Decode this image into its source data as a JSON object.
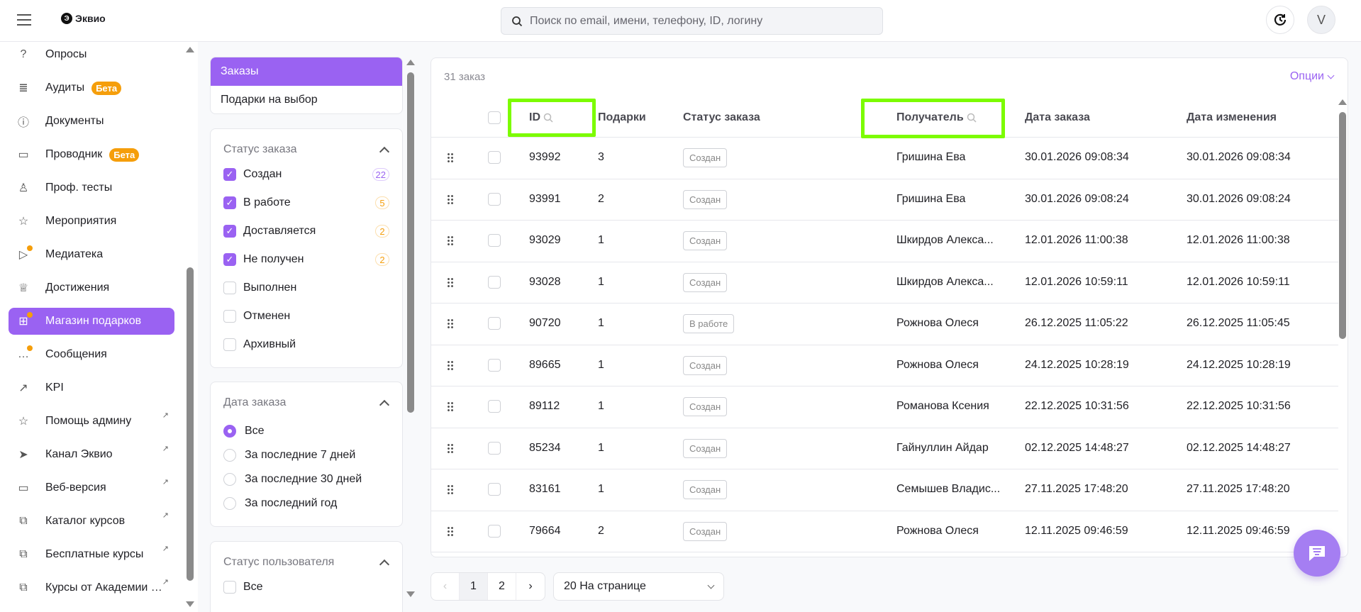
{
  "app": {
    "logo_text": "Эквио",
    "avatar_initial": "V"
  },
  "search": {
    "placeholder": "Поиск по email, имени, телефону, ID, логину"
  },
  "sidebar": {
    "items": [
      {
        "label": "Опросы",
        "icon": "question-chat-icon"
      },
      {
        "label": "Аудиты",
        "icon": "audit-doc-icon",
        "badge": "Бета"
      },
      {
        "label": "Документы",
        "icon": "info-icon"
      },
      {
        "label": "Проводник",
        "icon": "folder-icon",
        "badge": "Бета"
      },
      {
        "label": "Проф. тесты",
        "icon": "user-check-icon"
      },
      {
        "label": "Мероприятия",
        "icon": "calendar-star-icon"
      },
      {
        "label": "Медиатека",
        "icon": "media-play-icon",
        "dot": true
      },
      {
        "label": "Достижения",
        "icon": "trophy-icon"
      },
      {
        "label": "Магазин подарков",
        "icon": "gift-icon",
        "dot": true,
        "active": true
      },
      {
        "label": "Сообщения",
        "icon": "message-icon",
        "dot": true
      },
      {
        "label": "KPI",
        "icon": "trend-up-icon"
      },
      {
        "label": "Помощь админу",
        "icon": "star-icon",
        "external": true
      },
      {
        "label": "Канал Эквио",
        "icon": "telegram-icon",
        "external": true
      },
      {
        "label": "Веб-версия",
        "icon": "monitor-icon",
        "external": true
      },
      {
        "label": "Каталог курсов",
        "icon": "external-link-icon",
        "external": true
      },
      {
        "label": "Бесплатные курсы",
        "icon": "external-link-icon",
        "external": true
      },
      {
        "label": "Курсы от Академии Эквио",
        "icon": "external-link-icon",
        "external": true
      }
    ]
  },
  "tabs": [
    {
      "label": "Заказы",
      "active": true
    },
    {
      "label": "Подарки на выбор"
    }
  ],
  "filters": {
    "order_status": {
      "title": "Статус заказа",
      "options": [
        {
          "label": "Создан",
          "checked": true,
          "count": "22",
          "color": "#9a62f2"
        },
        {
          "label": "В работе",
          "checked": true,
          "count": "5",
          "color": "#f59e0b"
        },
        {
          "label": "Доставляется",
          "checked": true,
          "count": "2",
          "color": "#f59e0b"
        },
        {
          "label": "Не получен",
          "checked": true,
          "count": "2",
          "color": "#f59e0b"
        },
        {
          "label": "Выполнен",
          "checked": false
        },
        {
          "label": "Отменен",
          "checked": false
        },
        {
          "label": "Архивный",
          "checked": false
        }
      ]
    },
    "order_date": {
      "title": "Дата заказа",
      "options": [
        {
          "label": "Все",
          "selected": true
        },
        {
          "label": "За последние 7 дней"
        },
        {
          "label": "За последние 30 дней"
        },
        {
          "label": "За последний год"
        }
      ]
    },
    "user_status": {
      "title": "Статус пользователя",
      "options": [
        {
          "label": "Все",
          "checked": false
        }
      ]
    }
  },
  "table": {
    "count_label": "31 заказ",
    "options_label": "Опции",
    "columns": [
      "ID",
      "Подарки",
      "Статус заказа",
      "Получатель",
      "Дата заказа",
      "Дата изменения"
    ],
    "rows": [
      [
        "93992",
        "3",
        "Создан",
        "Гришина Ева",
        "30.01.2026 09:08:34",
        "30.01.2026 09:08:34"
      ],
      [
        "93991",
        "2",
        "Создан",
        "Гришина Ева",
        "30.01.2026 09:08:24",
        "30.01.2026 09:08:24"
      ],
      [
        "93029",
        "1",
        "Создан",
        "Шкирдов Алекса...",
        "12.01.2026 11:00:38",
        "12.01.2026 11:00:38"
      ],
      [
        "93028",
        "1",
        "Создан",
        "Шкирдов Алекса...",
        "12.01.2026 10:59:11",
        "12.01.2026 10:59:11"
      ],
      [
        "90720",
        "1",
        "В работе",
        "Рожнова Олеся",
        "26.12.2025 11:05:22",
        "26.12.2025 11:05:45"
      ],
      [
        "89665",
        "1",
        "Создан",
        "Рожнова Олеся",
        "24.12.2025 10:28:19",
        "24.12.2025 10:28:19"
      ],
      [
        "89112",
        "1",
        "Создан",
        "Романова Ксения",
        "22.12.2025 10:31:56",
        "22.12.2025 10:31:56"
      ],
      [
        "85234",
        "1",
        "Создан",
        "Гайнуллин Айдар",
        "02.12.2025 14:48:27",
        "02.12.2025 14:48:27"
      ],
      [
        "83161",
        "1",
        "Создан",
        "Семышев Владис...",
        "27.11.2025 17:48:20",
        "27.11.2025 17:48:20"
      ],
      [
        "79664",
        "2",
        "Создан",
        "Рожнова Олеся",
        "12.11.2025 09:46:59",
        "12.11.2025 09:46:59"
      ]
    ]
  },
  "pagination": {
    "pages": [
      "1",
      "2"
    ],
    "current": "1",
    "per_page": "20 На странице"
  },
  "colors": {
    "accent": "#9a62f2",
    "beta": "#f59e0b",
    "highlight": "#7cfc00"
  }
}
